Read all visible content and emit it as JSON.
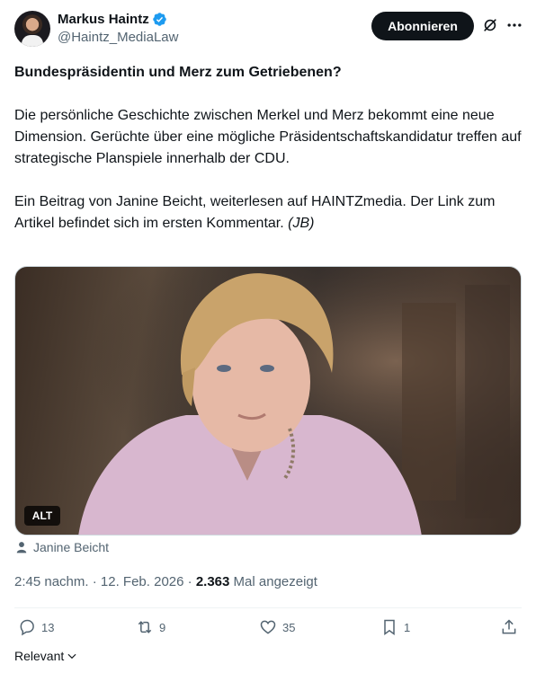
{
  "author": {
    "name": "Markus Haintz",
    "handle": "@Haintz_MediaLaw",
    "verified_icon": "verified-badge-icon",
    "verified_color": "#1d9bf0"
  },
  "follow_button": {
    "label": "Abonnieren"
  },
  "post": {
    "title": "Bundespräsidentin und Merz zum Getriebenen?",
    "paragraph1": "Die persönliche Geschichte zwischen Merkel und Merz bekommt eine neue Dimension. Gerüchte über eine mögliche Präsidentschaftskandidatur treffen auf strategische Planspiele innerhalb der CDU.",
    "paragraph2_main": "Ein Beitrag von Janine Beicht, weiterlesen auf HAINTZmedia. Der Link zum Artikel befindet sich im ersten Kommentar.",
    "paragraph2_signature": "(JB)"
  },
  "media": {
    "alt_badge": "ALT",
    "tagged_user": "Janine Beicht"
  },
  "meta": {
    "time": "2:45 nachm.",
    "separator": "·",
    "date": "12. Feb. 2026",
    "views_count": "2.363",
    "views_label": "Mal angezeigt"
  },
  "actions": {
    "replies": "13",
    "reposts": "9",
    "likes": "35",
    "bookmarks": "1"
  },
  "sort": {
    "label": "Relevant"
  },
  "colors": {
    "text": "#0f1419",
    "secondary": "#536471",
    "button_bg": "#0f1419"
  }
}
